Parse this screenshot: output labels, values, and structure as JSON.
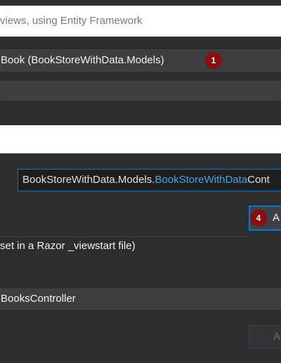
{
  "template_description": "views, using Entity Framework",
  "model_class": {
    "value": "Book (BookStoreWithData.Models)",
    "badge": "1"
  },
  "data_context": {
    "prefix": "BookStoreWithData.Models.",
    "highlight": "BookStoreWithData",
    "suffix": "Cont"
  },
  "add_context_button": {
    "badge": "4",
    "label": "A"
  },
  "layout_note": "set in a Razor _viewstart file)",
  "controller_name": {
    "value": "BooksController"
  },
  "add_button": {
    "label": "A"
  },
  "colors": {
    "background": "#2d2d30",
    "field": "#3e3e42",
    "accent": "#007acc",
    "badge": "#8b0e0e",
    "highlight_text": "#4aa3e8"
  }
}
